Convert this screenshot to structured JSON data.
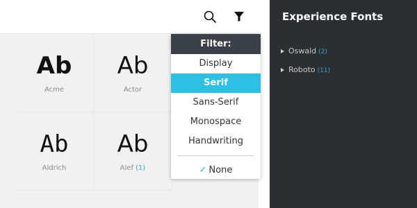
{
  "toolbar": {
    "search_icon": "search-icon",
    "filter_icon": "filter-icon"
  },
  "fonts": [
    {
      "sample": "Ab",
      "name": "Acme",
      "count": ""
    },
    {
      "sample": "Ab",
      "name": "Actor",
      "count": ""
    },
    {
      "sample": "Ab",
      "name": "Aldrich",
      "count": ""
    },
    {
      "sample": "Ab",
      "name": "Alef",
      "count": "(1)"
    }
  ],
  "filter_menu": {
    "header": "Filter:",
    "options": [
      "Display",
      "Serif",
      "Sans-Serif",
      "Monospace",
      "Handwriting"
    ],
    "selected": "Serif",
    "none_label": "None"
  },
  "sidebar": {
    "title": "Experience Fonts",
    "items": [
      {
        "label": "Oswald",
        "count": "(2)"
      },
      {
        "label": "Roboto",
        "count": "(11)"
      }
    ]
  },
  "colors": {
    "accent": "#2fbfe3",
    "sidebar_bg": "#2b2f33",
    "menu_header_bg": "#3b4149"
  }
}
